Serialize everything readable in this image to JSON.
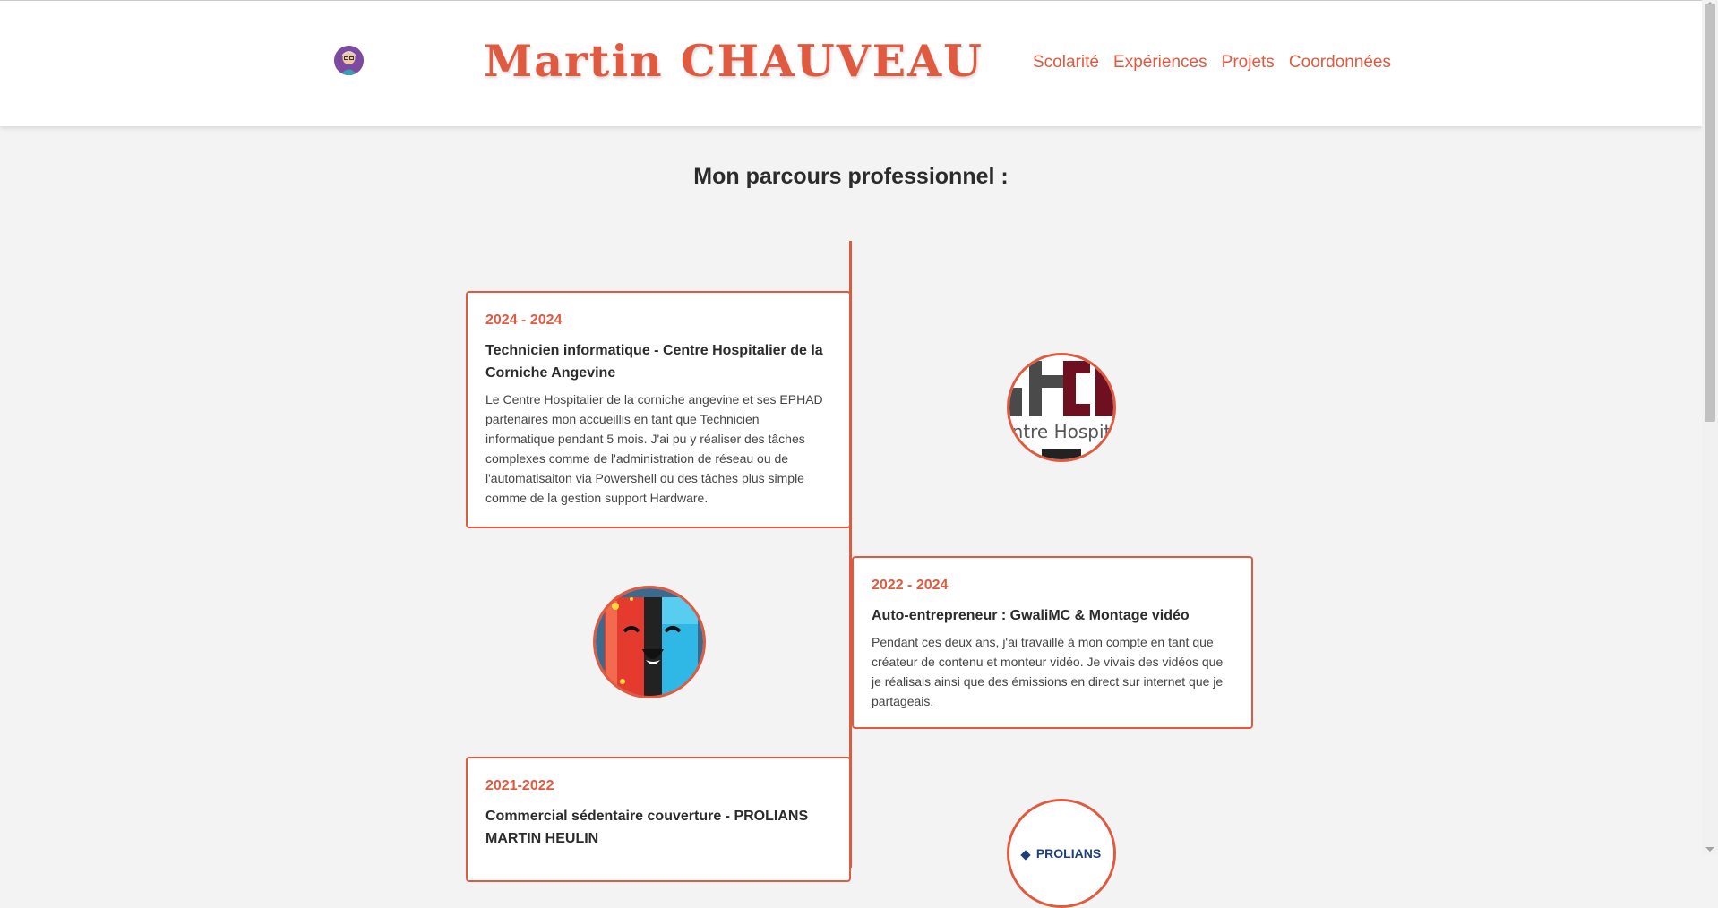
{
  "header": {
    "title": "Martin CHAUVEAU",
    "avatar_icon": "avatar-icon",
    "nav": [
      "Scolarité",
      "Expériences",
      "Projets",
      "Coordonnées"
    ]
  },
  "main": {
    "section_title": "Mon parcours professionnel :",
    "experiences": [
      {
        "date": "2024 - 2024",
        "title": "Technicien informatique - Centre Hospitalier de la Corniche Angevine",
        "description": "Le Centre Hospitalier de la corniche angevine et ses EPHAD partenaires mon accueillis en tant que Technicien informatique pendant 5 mois. J'ai pu y réaliser des tâches complexes comme de l'administration de réseau ou de l'automatisaiton via Powershell ou des tâches plus simple comme de la gestion support Hardware.",
        "logo_text": "ntre Hospit",
        "logo_icon": "centre-hospitalier-logo"
      },
      {
        "date": "2022 - 2024",
        "title": "Auto-entrepreneur : GwaliMC & Montage vidéo",
        "description": "Pendant ces deux ans, j'ai travaillé à mon compte en tant que créateur de contenu et monteur vidéo. Je vivais des vidéos que je réalisais ainsi que des émissions en direct sur internet que je partageais.",
        "logo_icon": "gwalimc-logo"
      },
      {
        "date": "2021-2022",
        "title": "Commercial sédentaire couverture - PROLIANS MARTIN HEULIN",
        "logo_text": "PROLIANS",
        "logo_icon": "prolians-logo"
      }
    ]
  },
  "colors": {
    "accent": "#e05a40",
    "background": "#f3f3f3",
    "text": "#2b2b2b"
  }
}
